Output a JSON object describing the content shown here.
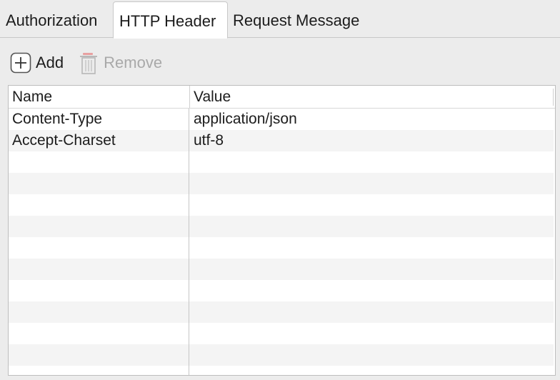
{
  "tabs": [
    {
      "label": "Authorization"
    },
    {
      "label": "HTTP Header"
    },
    {
      "label": "Request Message"
    }
  ],
  "toolbar": {
    "add_label": "Add",
    "add_icon": "plus-square-icon",
    "remove_label": "Remove",
    "remove_icon": "trash-icon"
  },
  "table": {
    "columns": [
      "Name",
      "Value"
    ],
    "rows": [
      {
        "name": "Content-Type",
        "value": "application/json"
      },
      {
        "name": "Accept-Charset",
        "value": "utf-8"
      },
      {
        "name": "",
        "value": ""
      },
      {
        "name": "",
        "value": ""
      },
      {
        "name": "",
        "value": ""
      },
      {
        "name": "",
        "value": ""
      },
      {
        "name": "",
        "value": ""
      },
      {
        "name": "",
        "value": ""
      },
      {
        "name": "",
        "value": ""
      },
      {
        "name": "",
        "value": ""
      },
      {
        "name": "",
        "value": ""
      },
      {
        "name": "",
        "value": ""
      },
      {
        "name": "",
        "value": ""
      }
    ]
  },
  "colors": {
    "window_bg": "#ececec",
    "table_bg": "#ffffff",
    "stripe": "#f4f4f4",
    "disabled_text": "#a9a9a9",
    "trash_accent": "#e8a0a0"
  }
}
